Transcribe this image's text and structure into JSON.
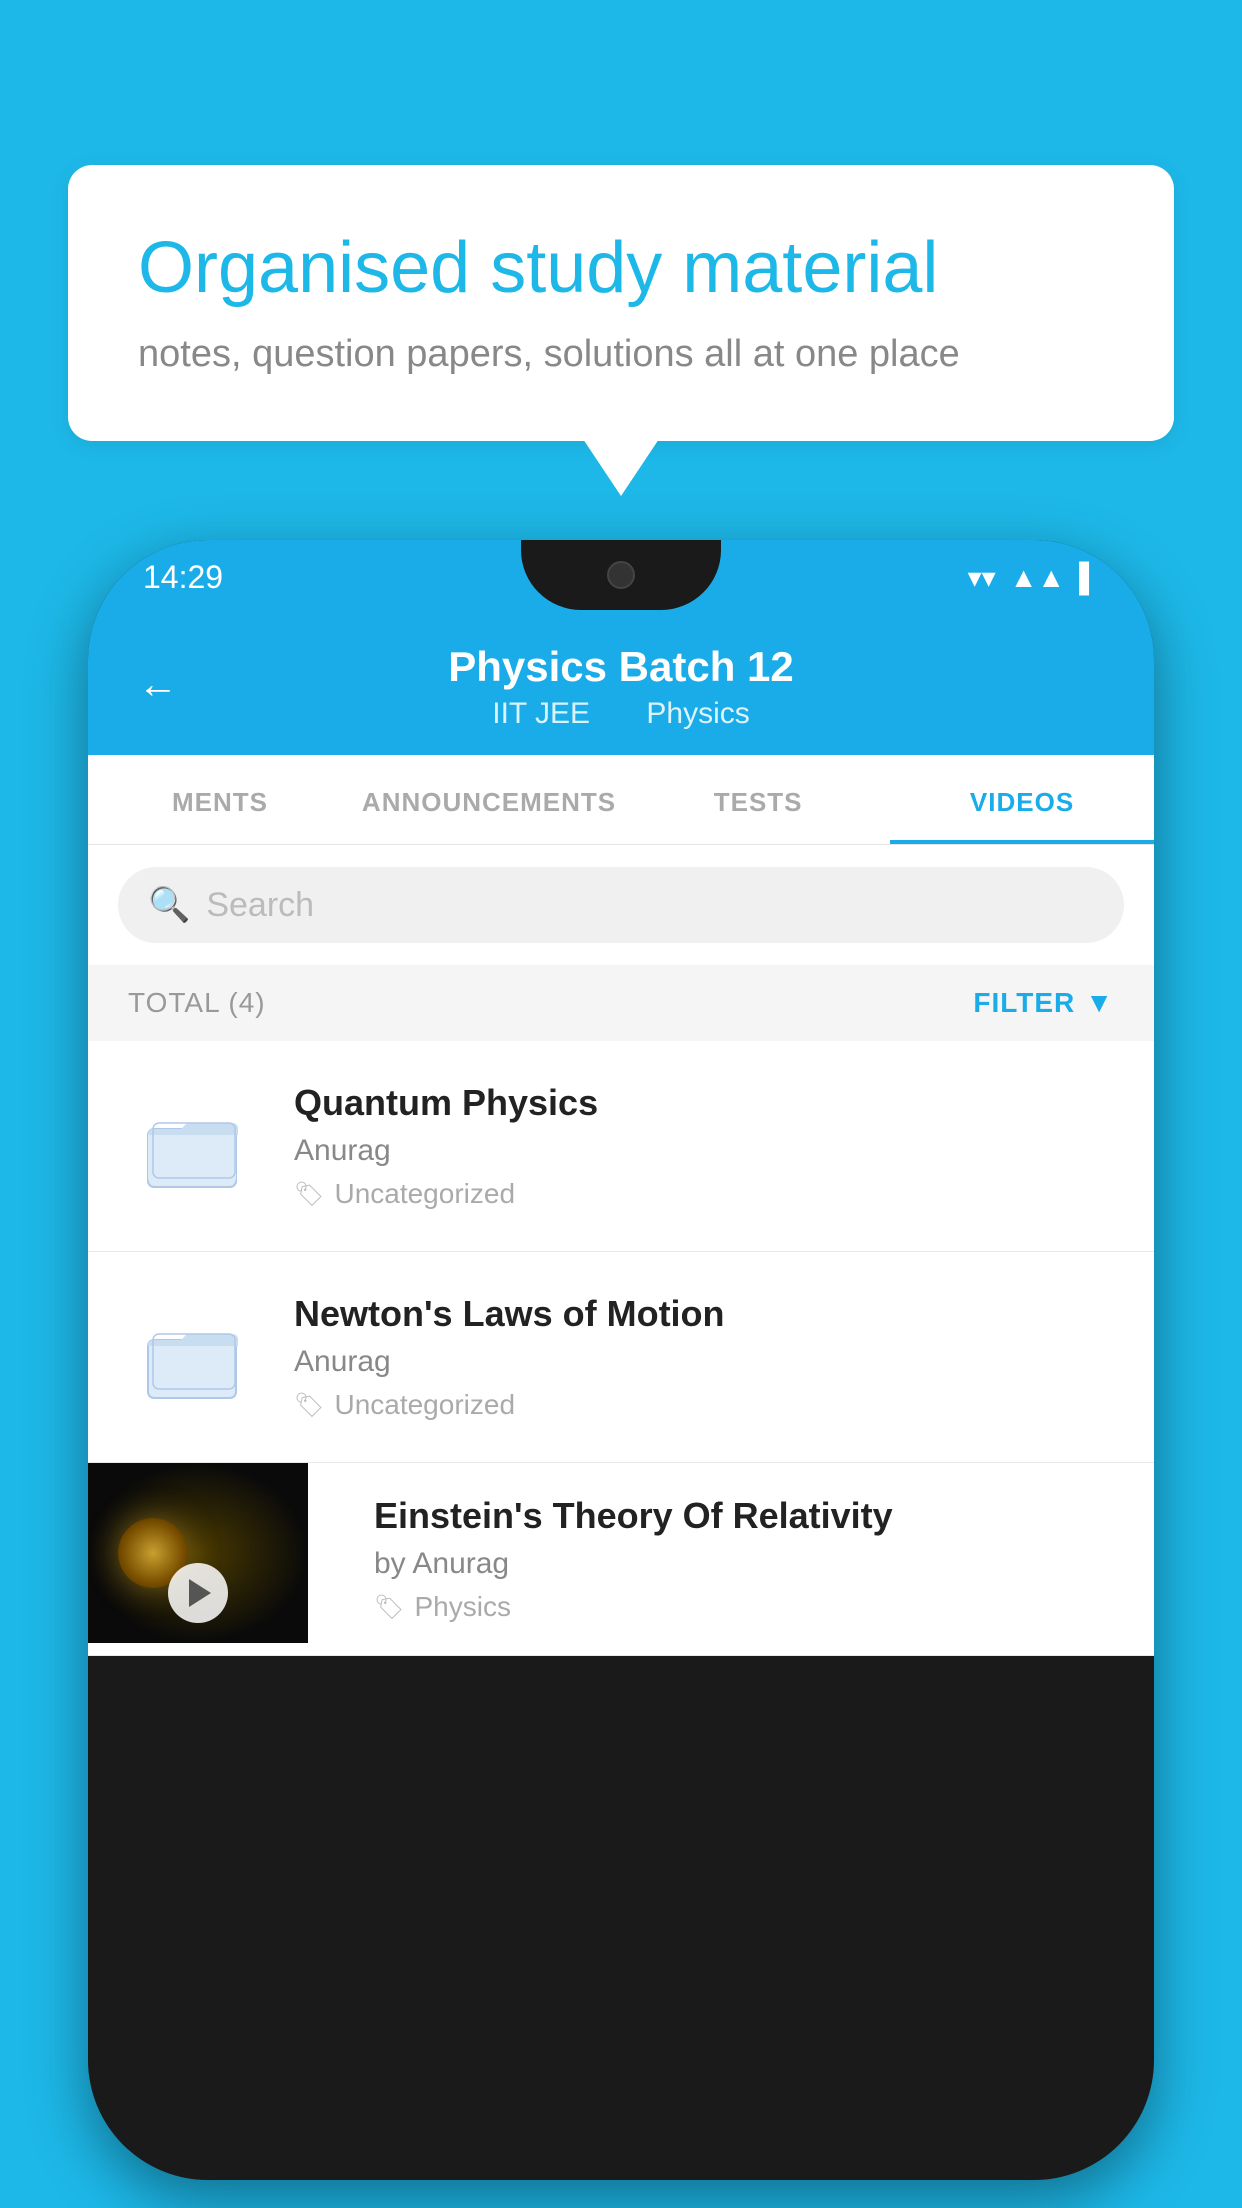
{
  "background_color": "#1db8e8",
  "bubble": {
    "title": "Organised study material",
    "subtitle": "notes, question papers, solutions all at one place"
  },
  "phone": {
    "status_bar": {
      "time": "14:29",
      "icons": [
        "wifi",
        "signal",
        "battery"
      ]
    },
    "header": {
      "back_label": "←",
      "title": "Physics Batch 12",
      "subtitle_left": "IIT JEE",
      "subtitle_right": "Physics"
    },
    "tabs": [
      {
        "label": "MENTS",
        "active": false
      },
      {
        "label": "ANNOUNCEMENTS",
        "active": false
      },
      {
        "label": "TESTS",
        "active": false
      },
      {
        "label": "VIDEOS",
        "active": true
      }
    ],
    "search": {
      "placeholder": "Search"
    },
    "filter_row": {
      "total_label": "TOTAL (4)",
      "filter_label": "FILTER"
    },
    "videos": [
      {
        "id": 1,
        "title": "Quantum Physics",
        "author": "Anurag",
        "tag": "Uncategorized",
        "has_thumb": false
      },
      {
        "id": 2,
        "title": "Newton's Laws of Motion",
        "author": "Anurag",
        "tag": "Uncategorized",
        "has_thumb": false
      },
      {
        "id": 3,
        "title": "Einstein's Theory Of Relativity",
        "author": "Anurag",
        "tag": "Physics",
        "has_thumb": true
      }
    ]
  }
}
